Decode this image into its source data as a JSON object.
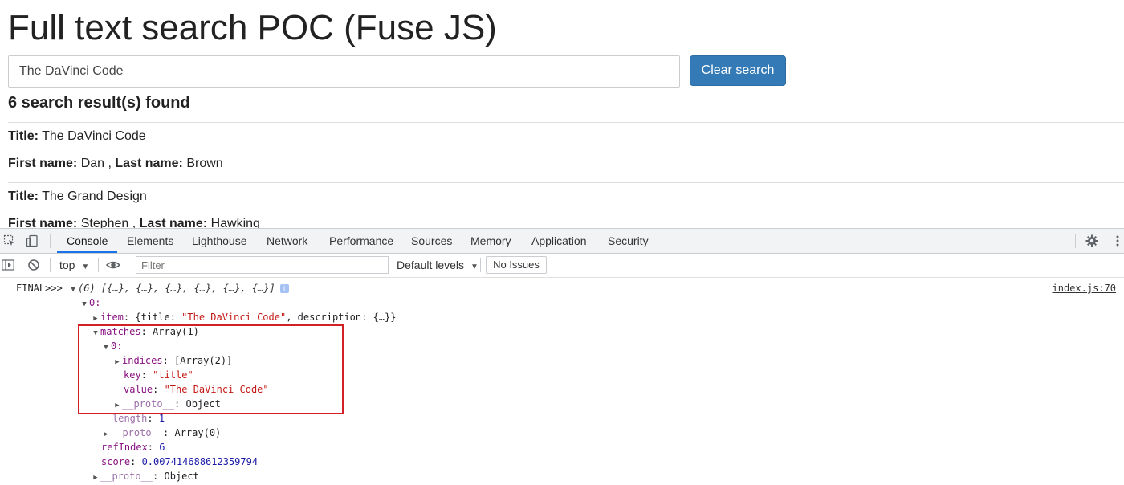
{
  "page": {
    "title": "Full text search POC (Fuse JS)",
    "search_value": "The DaVinci Code",
    "clear_button": "Clear search",
    "results_count": "6 search result(s) found",
    "title_label": "Title:",
    "first_name_label": "First name:",
    "last_name_label": "Last name:",
    "results": [
      {
        "title": "The DaVinci Code",
        "first_name": "Dan",
        "last_name": "Brown"
      },
      {
        "title": "The Grand Design",
        "first_name": "Stephen",
        "last_name": "Hawking"
      }
    ]
  },
  "devtools": {
    "tabs": [
      "Console",
      "Elements",
      "Lighthouse",
      "Network",
      "Performance",
      "Sources",
      "Memory",
      "Application",
      "Security"
    ],
    "active_tab": "Console",
    "context": "top",
    "filter_placeholder": "Filter",
    "levels": "Default levels",
    "issues": "No Issues",
    "icons": [
      "inspect-icon",
      "device-toolbar-icon",
      "sidebar-toggle-icon",
      "clear-console-icon",
      "live-expression-eye-icon",
      "settings-gear-icon",
      "more-vert-icon"
    ]
  },
  "console": {
    "prefix": "FINAL>>>",
    "summary": "(6) [{…}, {…}, {…}, {…}, {…}, {…}]",
    "source_link": "index.js:70",
    "item0_key": "0:",
    "item_key": "item",
    "item_value_pre": "{title: ",
    "item_value_title": "\"The DaVinci Code\"",
    "item_value_post": ", description: {…}}",
    "matches_key": "matches",
    "matches_value": "Array(1)",
    "match0_key": "0:",
    "indices_key": "indices",
    "indices_value": "[Array(2)]",
    "key_key": "key",
    "key_value": "\"title\"",
    "value_key": "value",
    "value_value": "\"The DaVinci Code\"",
    "proto_key": "__proto__",
    "proto_object": "Object",
    "length_key": "length",
    "length_value": "1",
    "proto_array": "Array(0)",
    "refindex_key": "refIndex",
    "refindex_value": "6",
    "score_key": "score",
    "score_value": "0.007414688612359794"
  }
}
